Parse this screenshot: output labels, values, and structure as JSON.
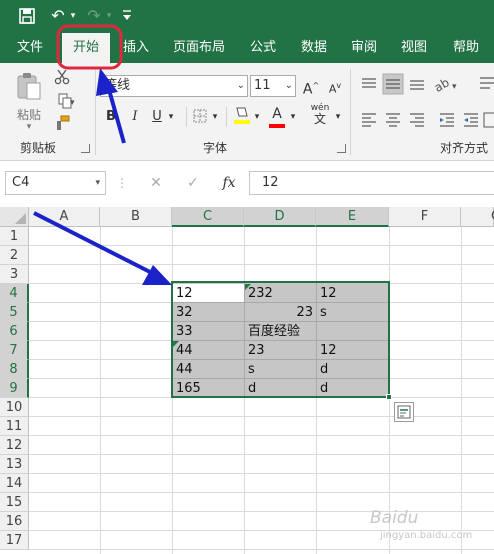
{
  "quick_access": {
    "save_icon": "save-icon",
    "undo_icon": "undo-icon",
    "redo_icon": "redo-icon",
    "customize_icon": "customize-icon",
    "undo_glyph": "↶",
    "redo_glyph": "↷",
    "dd_glyph": "▾"
  },
  "tabs": [
    {
      "label": "文件"
    },
    {
      "label": "开始",
      "active": true
    },
    {
      "label": "插入"
    },
    {
      "label": "页面布局"
    },
    {
      "label": "公式"
    },
    {
      "label": "数据"
    },
    {
      "label": "审阅"
    },
    {
      "label": "视图"
    },
    {
      "label": "帮助"
    }
  ],
  "ribbon": {
    "clipboard": {
      "group_label": "剪贴板",
      "paste_label": "粘贴",
      "cut_icon": "scissors-icon",
      "copy_icon": "copy-icon",
      "format_painter_icon": "format-painter-icon"
    },
    "font": {
      "group_label": "字体",
      "font_name": "等线",
      "font_size": "11",
      "grow_label": "A",
      "shrink_label": "A",
      "bold": "B",
      "italic": "I",
      "underline": "U",
      "font_color_label": "A",
      "phonetic_label": "wén",
      "fill_color": "#ffff00",
      "font_color": "#ff0000"
    },
    "alignment": {
      "group_label": "对齐方式"
    }
  },
  "formula_bar": {
    "name_box": "C4",
    "cancel_glyph": "✕",
    "enter_glyph": "✓",
    "fx_label": "fx",
    "value": "12"
  },
  "sheet": {
    "columns": [
      "A",
      "B",
      "C",
      "D",
      "E",
      "F",
      "G"
    ],
    "rows": [
      "1",
      "2",
      "3",
      "4",
      "5",
      "6",
      "7",
      "8",
      "9",
      "10",
      "11",
      "12",
      "13",
      "14",
      "15",
      "16",
      "17"
    ],
    "selection": "C4:E9",
    "cells": {
      "C4": "12",
      "D4": "232",
      "E4": "12",
      "C5": "32",
      "D5": "23",
      "E5": "s",
      "C6": "33",
      "D6": "百度经验",
      "E6": "",
      "C7": "44",
      "D7": "23",
      "E7": "12",
      "C8": "44",
      "D8": "s",
      "E8": "d",
      "C9": "165",
      "D9": "d",
      "E9": "d"
    }
  },
  "annotations": {
    "arrow_color": "#1a22c8",
    "highlight_color": "#e0283c"
  },
  "watermark": {
    "logo": "Baidu",
    "text": "jingyan.baidu.com"
  }
}
